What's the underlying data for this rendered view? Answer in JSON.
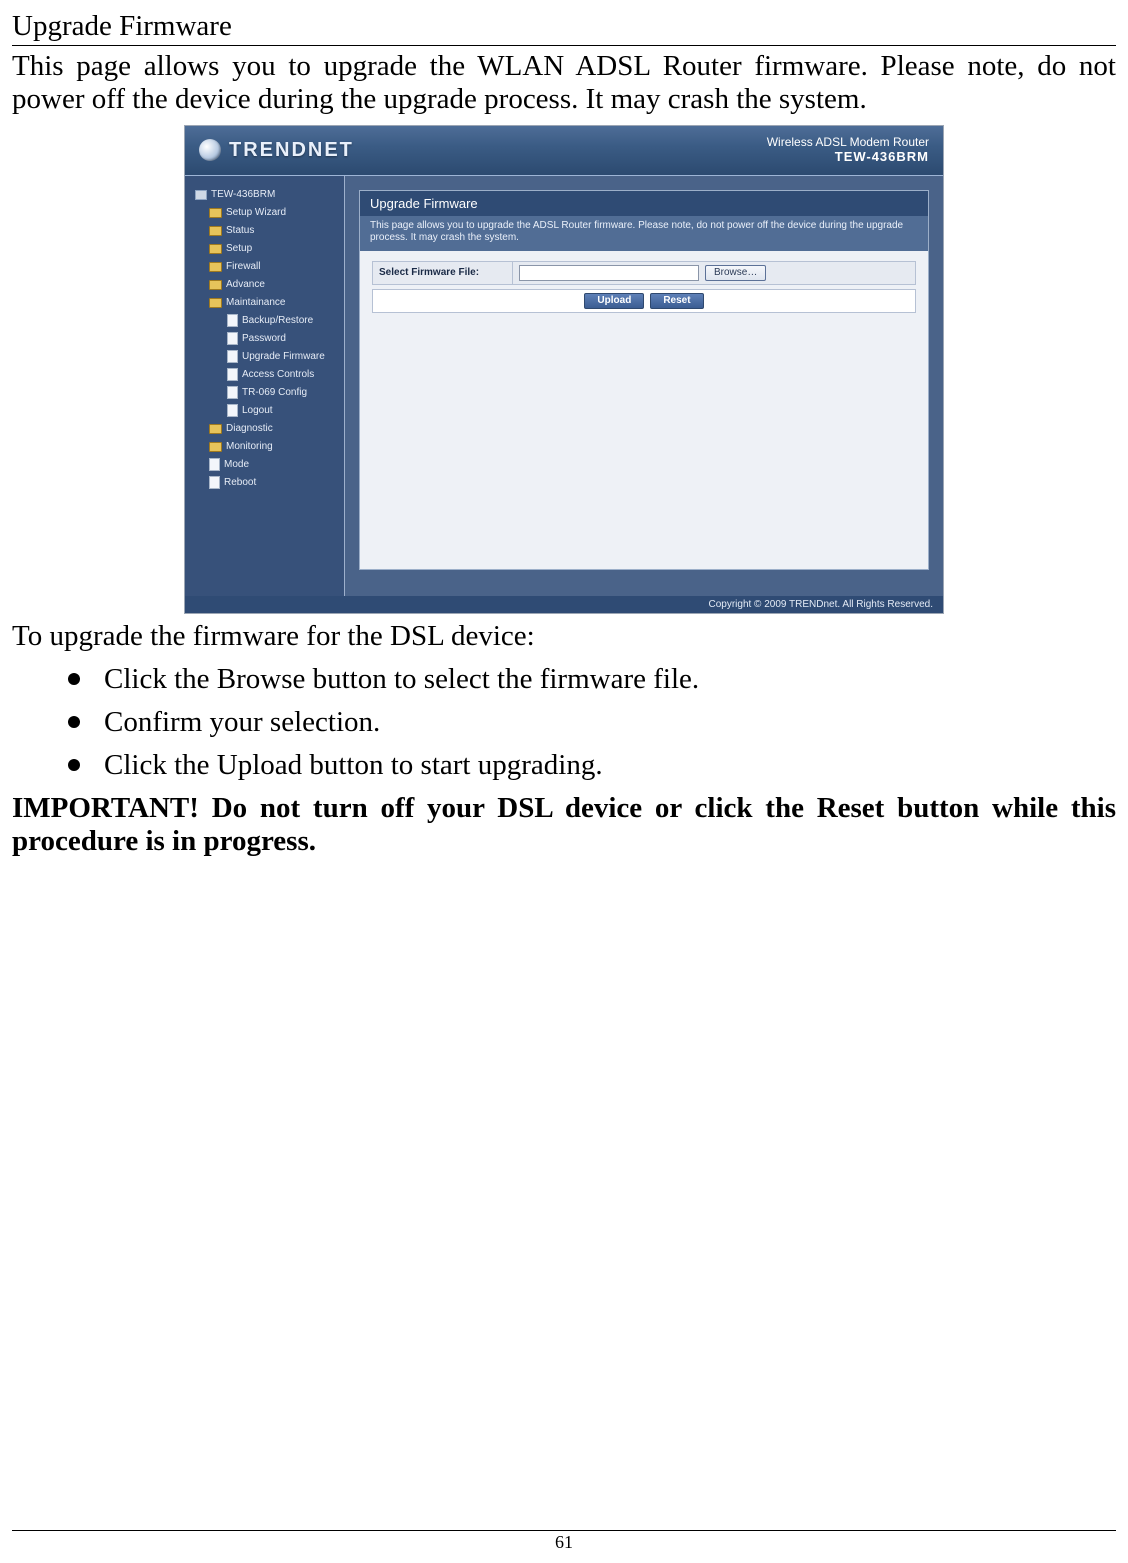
{
  "doc": {
    "section_title": "Upgrade Firmware",
    "intro": "This page allows you to upgrade the WLAN ADSL Router firmware. Please note, do not power off the device during the upgrade process. It may crash the system.",
    "after_figure": "To upgrade the firmware for the DSL device:",
    "bullets": [
      "Click the Browse button to select the firmware file.",
      "Confirm your selection.",
      "Click the Upload button to start upgrading."
    ],
    "important": "IMPORTANT! Do not turn off your DSL device or click the Reset button while this procedure is in progress.",
    "page_number": "61"
  },
  "router": {
    "header": {
      "brand": "TRENDNET",
      "product_line1": "Wireless ADSL Modem Router",
      "product_line2": "TEW-436BRM"
    },
    "sidebar": {
      "root": "TEW-436BRM",
      "items_l1": [
        "Setup Wizard",
        "Status",
        "Setup",
        "Firewall",
        "Advance",
        "Maintainance"
      ],
      "maint_children": [
        "Backup/Restore",
        "Password",
        "Upgrade Firmware",
        "Access Controls",
        "TR-069 Config",
        "Logout"
      ],
      "items_l1b": [
        "Diagnostic",
        "Monitoring",
        "Mode",
        "Reboot"
      ]
    },
    "panel": {
      "title": "Upgrade Firmware",
      "desc": "This page allows you to upgrade the ADSL Router firmware. Please note, do not power off the device during the upgrade process. It may crash the system.",
      "file_label": "Select Firmware File:",
      "browse_label": "Browse…",
      "upload_label": "Upload",
      "reset_label": "Reset"
    },
    "footer": "Copyright © 2009 TRENDnet. All Rights Reserved."
  }
}
